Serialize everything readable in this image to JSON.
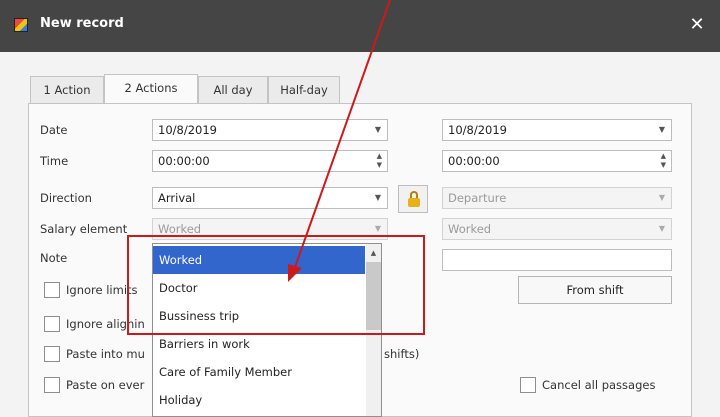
{
  "window": {
    "title": "New record",
    "close_glyph": "✕"
  },
  "tabs": [
    {
      "label": "1 Action"
    },
    {
      "label": "2 Actions",
      "active": true
    },
    {
      "label": "All day"
    },
    {
      "label": "Half-day"
    }
  ],
  "form": {
    "date_label": "Date",
    "time_label": "Time",
    "direction_label": "Direction",
    "salary_label": "Salary element",
    "note_label": "Note",
    "date_left": "10/8/2019",
    "date_right": "10/8/2019",
    "time_left": "00:00:00",
    "time_right": "00:00:00",
    "direction_left": "Arrival",
    "direction_right": "Departure",
    "salary_left": "Worked",
    "salary_right": "Worked",
    "note_left": "",
    "note_right": ""
  },
  "checkboxes": [
    {
      "label": "Ignore limits"
    },
    {
      "label": "Ignore alignin"
    },
    {
      "label": "Paste into mu"
    },
    {
      "label": "Paste on ever"
    }
  ],
  "right_panel": {
    "hidden_fragment": "shifts)",
    "from_shift_label": "From shift",
    "cancel_all_label": "Cancel all passages"
  },
  "dropdown": {
    "options": [
      "Worked",
      "Doctor",
      "Bussiness trip",
      "Barriers in work",
      "Care of Family Member",
      "Holiday"
    ],
    "selected": "Worked"
  },
  "annotation": {
    "color": "#cc1a1a"
  },
  "icons": {
    "lock": "lock-icon",
    "dropdown": "chevron-down-icon",
    "spin": "spin-arrows-icon",
    "close": "close-icon"
  }
}
